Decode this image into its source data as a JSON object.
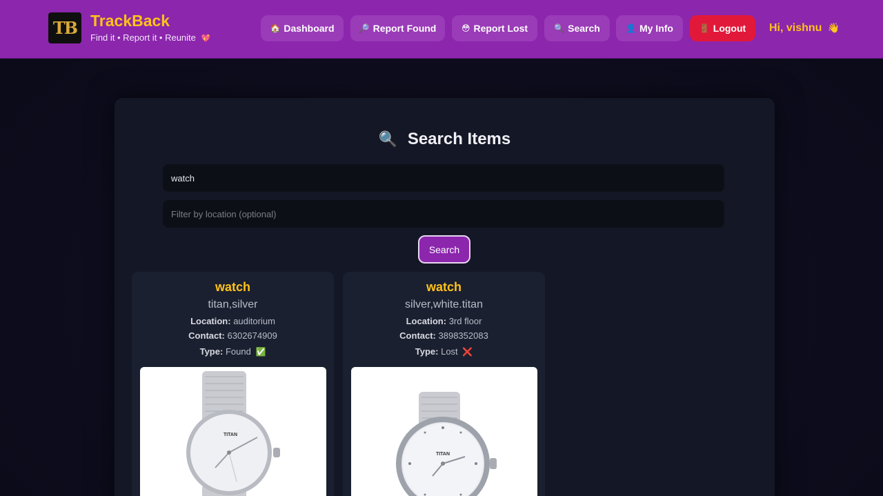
{
  "header": {
    "logo_text": "TB",
    "title": "TrackBack",
    "tagline": "Find it • Report it • Reunite",
    "tagline_icon": "💖",
    "greeting": "Hi, vishnu",
    "greeting_icon": "👋"
  },
  "nav": [
    {
      "icon": "🏠",
      "label": "Dashboard"
    },
    {
      "icon": "🔎",
      "label": "Report Found"
    },
    {
      "icon": "😳",
      "label": "Report Lost"
    },
    {
      "icon": "🔍",
      "label": "Search"
    },
    {
      "icon": "👤",
      "label": "My Info"
    },
    {
      "icon": "🚪",
      "label": "Logout"
    }
  ],
  "search": {
    "title": "Search Items",
    "title_icon": "🔍",
    "query_value": "watch",
    "location_placeholder": "Filter by location (optional)",
    "button_label": "Search"
  },
  "results": [
    {
      "title": "watch",
      "description": "titan,silver",
      "location_label": "Location:",
      "location": "auditorium",
      "contact_label": "Contact:",
      "contact": "6302674909",
      "type_label": "Type:",
      "type": "Found",
      "type_icon": "✅"
    },
    {
      "title": "watch",
      "description": "silver,white.titan",
      "location_label": "Location:",
      "location": "3rd floor",
      "contact_label": "Contact:",
      "contact": "3898352083",
      "type_label": "Type:",
      "type": "Lost",
      "type_icon": "❌"
    }
  ],
  "watch_brand": "TITAN",
  "colors": {
    "navbar": "#8b26ad",
    "accent_yellow": "#ffc21a",
    "logout_red": "#e2183a",
    "card_bg": "#1b2030"
  }
}
